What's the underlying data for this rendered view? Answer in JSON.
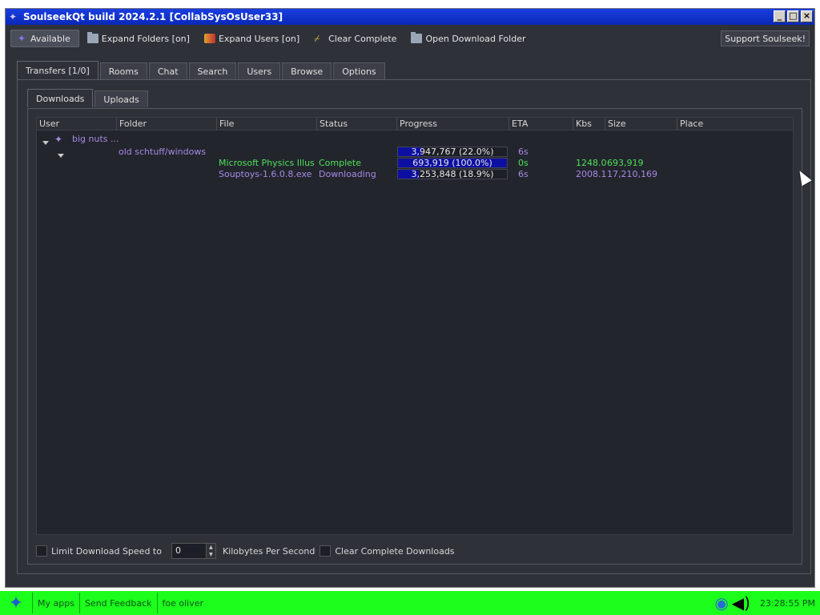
{
  "window": {
    "title": "SoulseekQt build 2024.2.1 [CollabSysOsUser33]",
    "controls": [
      "_",
      "□",
      "×"
    ]
  },
  "toolbar": {
    "status_label": "Available",
    "expand_folders_label": "Expand Folders [on]",
    "expand_users_label": "Expand Users [on]",
    "clear_complete_label": "Clear Complete",
    "open_download_folder_label": "Open Download Folder",
    "support_label": "Support Soulseek!"
  },
  "main_tabs": [
    {
      "label": "Transfers [1/0]",
      "active": true
    },
    {
      "label": "Rooms"
    },
    {
      "label": "Chat"
    },
    {
      "label": "Search"
    },
    {
      "label": "Users"
    },
    {
      "label": "Browse"
    },
    {
      "label": "Options"
    }
  ],
  "sub_tabs": [
    {
      "label": "Downloads",
      "active": true
    },
    {
      "label": "Uploads"
    }
  ],
  "table": {
    "columns": [
      "User",
      "Folder",
      "File",
      "Status",
      "Progress",
      "ETA",
      "Kbs",
      "Size",
      "Place"
    ],
    "user_row": {
      "user": "big nuts ..."
    },
    "folder_row": {
      "folder": "old schtuff/windows",
      "progress_text": "3,947,767 (22.0%)",
      "progress_fraction": 0.22,
      "eta": "6s"
    },
    "files": [
      {
        "file": "Microsoft Physics Illust...",
        "status": "Complete",
        "progress_text": "693,919 (100.0%)",
        "progress_fraction": 1.0,
        "eta": "0s",
        "kbs": "1248.0",
        "size": "693,919",
        "color": "#4fe05a"
      },
      {
        "file": "Souptoys-1.6.0.8.exe",
        "status": "Downloading",
        "progress_text": "3,253,848 (18.9%)",
        "progress_fraction": 0.189,
        "eta": "6s",
        "kbs": "2008.1",
        "size": "17,210,169",
        "color": "#a889e6"
      }
    ]
  },
  "bottom": {
    "limit_label": "Limit Download Speed to",
    "speed_value": "0",
    "unit_label": "Kilobytes Per Second",
    "clear_complete_downloads_label": "Clear Complete Downloads"
  },
  "taskbar": {
    "items": [
      "My apps",
      "Send Feedback",
      "foe oliver"
    ],
    "clock": "23:28:55 PM"
  }
}
